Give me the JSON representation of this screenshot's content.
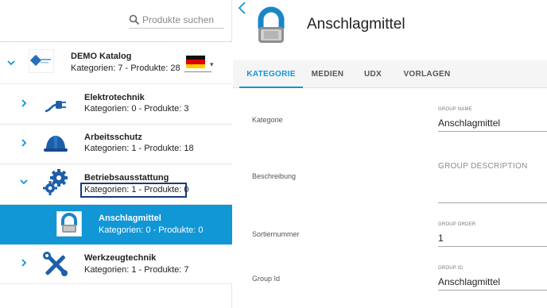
{
  "search": {
    "placeholder": "Produkte suchen"
  },
  "tree": {
    "root": {
      "title": "DEMO Katalog",
      "subtitle": "Kategorien: 7 - Produkte: 28"
    },
    "items": [
      {
        "title": "Elektrotechnik",
        "subtitle": "Kategorien: 0 - Produkte: 3"
      },
      {
        "title": "Arbeitsschutz",
        "subtitle": "Kategorien: 1 - Produkte: 18"
      },
      {
        "title": "Betriebsausstattung",
        "subtitle": "Kategorien: 1 - Produkte: 0"
      },
      {
        "title": "Anschlagmittel",
        "subtitle": "Kategorien: 0 - Produkte: 0"
      },
      {
        "title": "Werkzeugtechnik",
        "subtitle": "Kategorien: 1 - Produkte: 7"
      }
    ],
    "language_flag": "germany-flag-icon"
  },
  "detail": {
    "title": "Anschlagmittel",
    "tabs": [
      "KATEGORIE",
      "MEDIEN",
      "UDX",
      "VORLAGEN"
    ],
    "active_tab": "KATEGORIE",
    "fields": [
      {
        "label": "Kategorie",
        "caption": "GROUP NAME",
        "value": "Anschlagmittel"
      },
      {
        "label": "Beschreibung",
        "placeholder": "GROUP DESCRIPTION"
      },
      {
        "label": "Sortiernummer",
        "caption": "GROUP ORDER",
        "value": "1"
      },
      {
        "label": "Group Id",
        "caption": "GROUP ID",
        "value": "Anschlagmittel"
      }
    ]
  },
  "colors": {
    "accent": "#1196d6",
    "highlight_border": "#1a3a7c"
  }
}
